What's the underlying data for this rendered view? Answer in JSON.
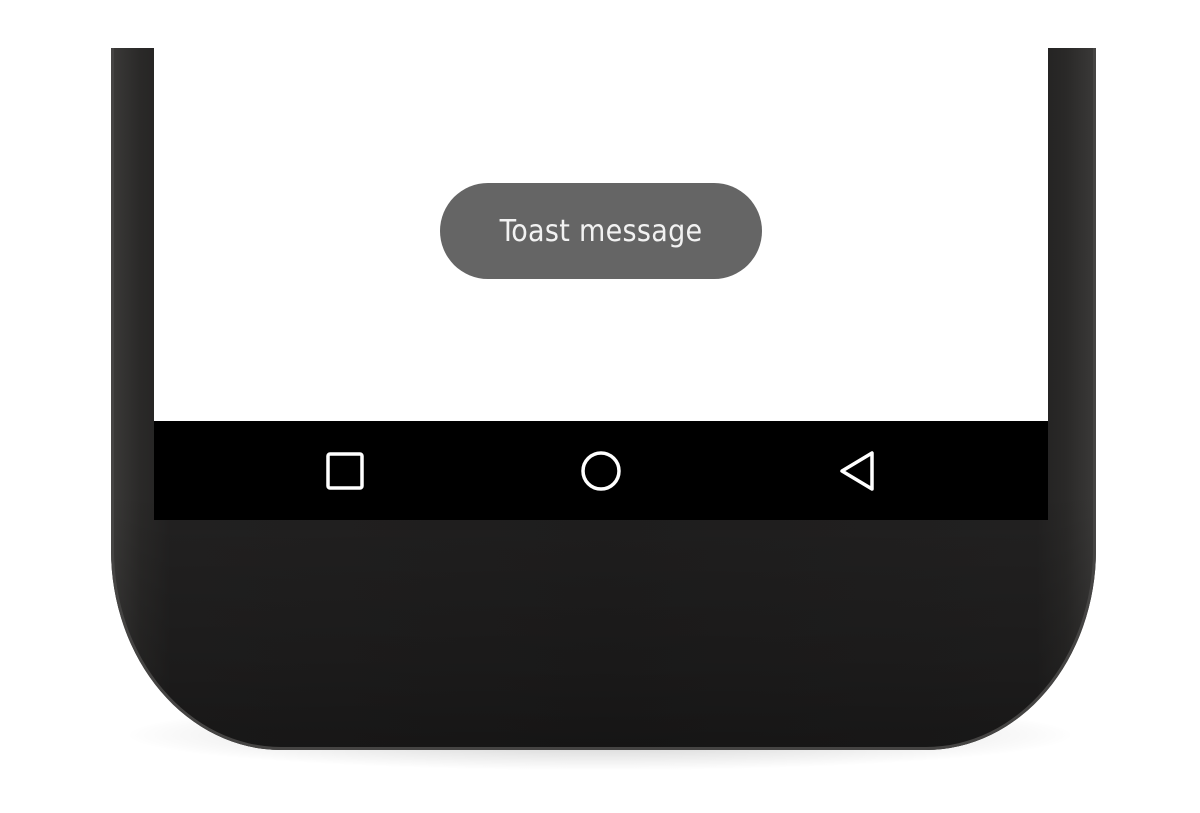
{
  "toast": {
    "message": "Toast message",
    "background_color": "#656565",
    "text_color": "#f2f2f2"
  },
  "navigation_bar": {
    "background_color": "#000000",
    "icon_color": "#ffffff",
    "buttons": [
      {
        "name": "recents",
        "icon": "square-icon"
      },
      {
        "name": "home",
        "icon": "circle-icon"
      },
      {
        "name": "back",
        "icon": "triangle-left-icon"
      }
    ]
  },
  "device": {
    "frame_color": "#1f1e1e",
    "screen_color": "#ffffff"
  }
}
